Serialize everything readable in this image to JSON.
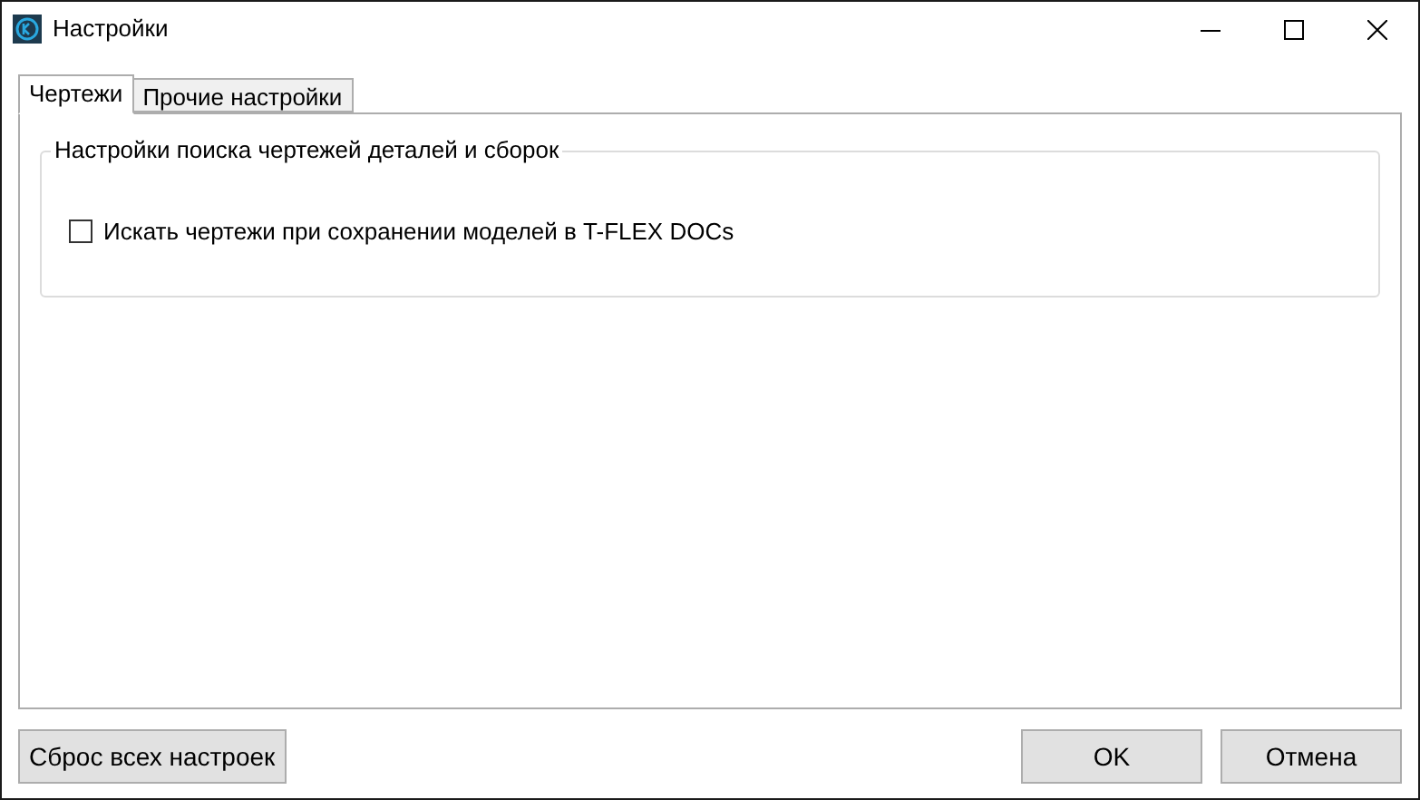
{
  "window": {
    "title": "Настройки"
  },
  "tabs": [
    {
      "label": "Чертежи",
      "selected": true
    },
    {
      "label": "Прочие настройки",
      "selected": false
    }
  ],
  "group": {
    "title": "Настройки поиска чертежей деталей и сборок",
    "options": [
      {
        "label": "Искать чертежи при сохранении моделей в T-FLEX DOCs",
        "checked": false
      }
    ]
  },
  "buttons": {
    "reset": "Сброс всех настроек",
    "ok": "OK",
    "cancel": "Отмена"
  }
}
